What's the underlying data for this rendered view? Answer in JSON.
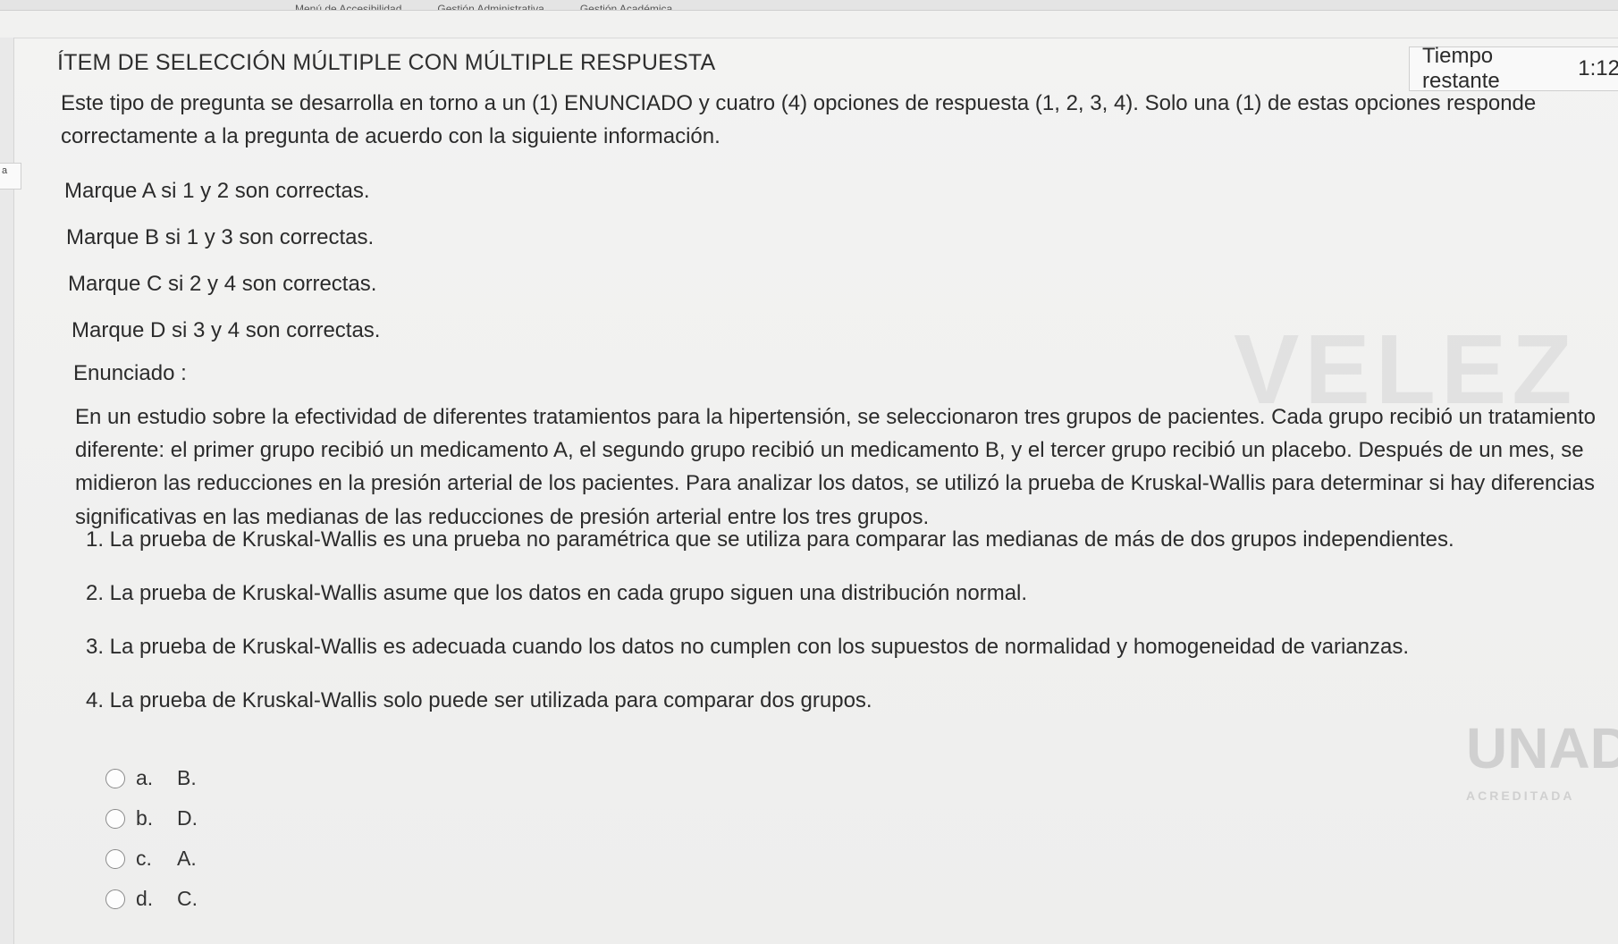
{
  "topbar": {
    "items": [
      "Menú de Accesibilidad",
      "Gestión Administrativa",
      "Gestión Académica"
    ]
  },
  "edge_tab": {
    "label": "a"
  },
  "question": {
    "heading": "ÍTEM DE SELECCIÓN MÚLTIPLE CON MÚLTIPLE RESPUESTA",
    "timer_label": "Tiempo restante",
    "timer_value": "1:12",
    "instructions_line1": "Este tipo de pregunta se desarrolla en torno a un (1) ENUNCIADO y cuatro (4) opciones de respuesta (1, 2, 3, 4). Solo una (1) de estas opciones responde",
    "instructions_line2": "correctamente a la pregunta de acuerdo con la siguiente información.",
    "rules": [
      "Marque A si 1 y 2 son correctas.",
      "Marque B si 1 y 3 son correctas.",
      "Marque C si 2 y 4 son correctas.",
      "Marque D si 3 y 4 son correctas."
    ],
    "enunciado_label": "Enunciado :",
    "statement": "En un estudio sobre la efectividad de diferentes tratamientos para la hipertensión, se seleccionaron tres grupos de pacientes. Cada grupo recibió un tratamiento diferente: el primer grupo recibió un medicamento A, el segundo grupo recibió un medicamento B, y el tercer grupo recibió un placebo. Después de un mes, se midieron las reducciones en la presión arterial de los pacientes. Para analizar los datos, se utilizó la prueba de Kruskal-Wallis para determinar si hay diferencias significativas en las medianas de las reducciones de presión arterial entre los tres grupos.",
    "statements": [
      "1. La prueba de Kruskal-Wallis es una prueba no paramétrica que se utiliza para comparar las medianas de más de dos grupos independientes.",
      "2. La prueba de Kruskal-Wallis asume que los datos en cada grupo siguen una distribución normal.",
      "3. La prueba de Kruskal-Wallis es adecuada cuando los datos no cumplen con los supuestos de normalidad y homogeneidad de varianzas.",
      "4. La prueba de Kruskal-Wallis solo puede ser utilizada para comparar dos grupos."
    ],
    "answers": [
      {
        "letter": "a.",
        "value": "B."
      },
      {
        "letter": "b.",
        "value": "D."
      },
      {
        "letter": "c.",
        "value": "A."
      },
      {
        "letter": "d.",
        "value": "C."
      }
    ]
  },
  "watermark": {
    "text": "VELEZ"
  },
  "logo": {
    "text": "UNAD",
    "sub": "ACREDITADA"
  }
}
